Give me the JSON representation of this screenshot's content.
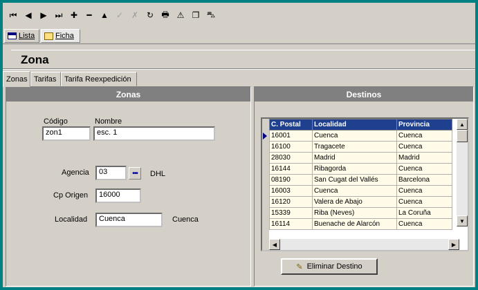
{
  "toolbar": {
    "icons": [
      {
        "name": "first-record-icon",
        "glyph": "⏮",
        "enabled": true
      },
      {
        "name": "prev-record-icon",
        "glyph": "◀",
        "enabled": true
      },
      {
        "name": "next-record-icon",
        "glyph": "▶",
        "enabled": true
      },
      {
        "name": "last-record-icon",
        "glyph": "⏭",
        "enabled": true
      },
      {
        "name": "add-record-icon",
        "glyph": "✚",
        "enabled": true
      },
      {
        "name": "delete-record-icon",
        "glyph": "━",
        "enabled": true
      },
      {
        "name": "edit-record-icon",
        "glyph": "▲",
        "enabled": true
      },
      {
        "name": "confirm-icon",
        "glyph": "✓",
        "enabled": false
      },
      {
        "name": "cancel-icon",
        "glyph": "✗",
        "enabled": false
      },
      {
        "name": "refresh-icon",
        "glyph": "↻",
        "enabled": true
      },
      {
        "name": "print-icon",
        "glyph": "🖶",
        "enabled": true
      },
      {
        "name": "warning-icon",
        "glyph": "⚠",
        "enabled": true
      },
      {
        "name": "window-icon",
        "glyph": "❐",
        "enabled": true
      },
      {
        "name": "exit-icon",
        "glyph": "⛍",
        "enabled": true
      }
    ]
  },
  "view_tabs": [
    {
      "label": "Lista",
      "icon": "table-icon"
    },
    {
      "label": "Ficha",
      "icon": "form-icon"
    }
  ],
  "form_title": "Zona",
  "page_tabs": [
    "Zonas",
    "Tarifas",
    "Tarifa Reexpedición"
  ],
  "zonas": {
    "header": "Zonas",
    "codigo_label": "Código",
    "codigo_value": "zon1",
    "nombre_label": "Nombre",
    "nombre_value": "esc. 1",
    "agencia_label": "Agencia",
    "agencia_value": "03",
    "agencia_name": "DHL",
    "cp_label": "Cp Origen",
    "cp_value": "16000",
    "localidad_label": "Localidad",
    "localidad_value": "Cuenca",
    "localidad_province": "Cuenca"
  },
  "destinos": {
    "header": "Destinos",
    "columns": [
      "C. Postal",
      "Localidad",
      "Provincia"
    ],
    "rows": [
      [
        "16001",
        "Cuenca",
        "Cuenca"
      ],
      [
        "16100",
        "Tragacete",
        "Cuenca"
      ],
      [
        "28030",
        "Madrid",
        "Madrid"
      ],
      [
        "16144",
        "Ribagorda",
        "Cuenca"
      ],
      [
        "08190",
        "San Cugat del Vallés",
        "Barcelona"
      ],
      [
        "16003",
        "Cuenca",
        "Cuenca"
      ],
      [
        "16120",
        "Valera de Abajo",
        "Cuenca"
      ],
      [
        "15339",
        "Riba (Neves)",
        "La Coruña"
      ],
      [
        "16114",
        "Buenache de Alarcón",
        "Cuenca"
      ]
    ],
    "delete_button": "Eliminar Destino"
  },
  "colors": {
    "frame": "#008080",
    "grid_header": "#1f3f8f",
    "grid_row": "#fffbe8",
    "panel_header": "#808080"
  }
}
